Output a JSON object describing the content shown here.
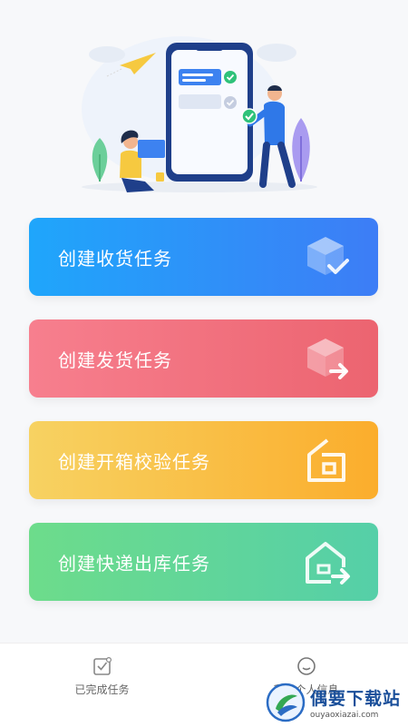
{
  "actions": {
    "receive_task": "创建收货任务",
    "ship_task": "创建发货任务",
    "inspect_task": "创建开箱校验任务",
    "express_task": "创建快递出库任务"
  },
  "tabbar": {
    "completed": "已完成任务",
    "profile": "我的个人信息"
  },
  "watermark": {
    "title": "偶要下载站",
    "url": "ouyaoxiazai.com"
  },
  "colors": {
    "receive": "#2f8ff8",
    "ship": "#f27481",
    "inspect": "#f9bf45",
    "express": "#60d69a",
    "illustration_blue": "#1f3f8a"
  }
}
